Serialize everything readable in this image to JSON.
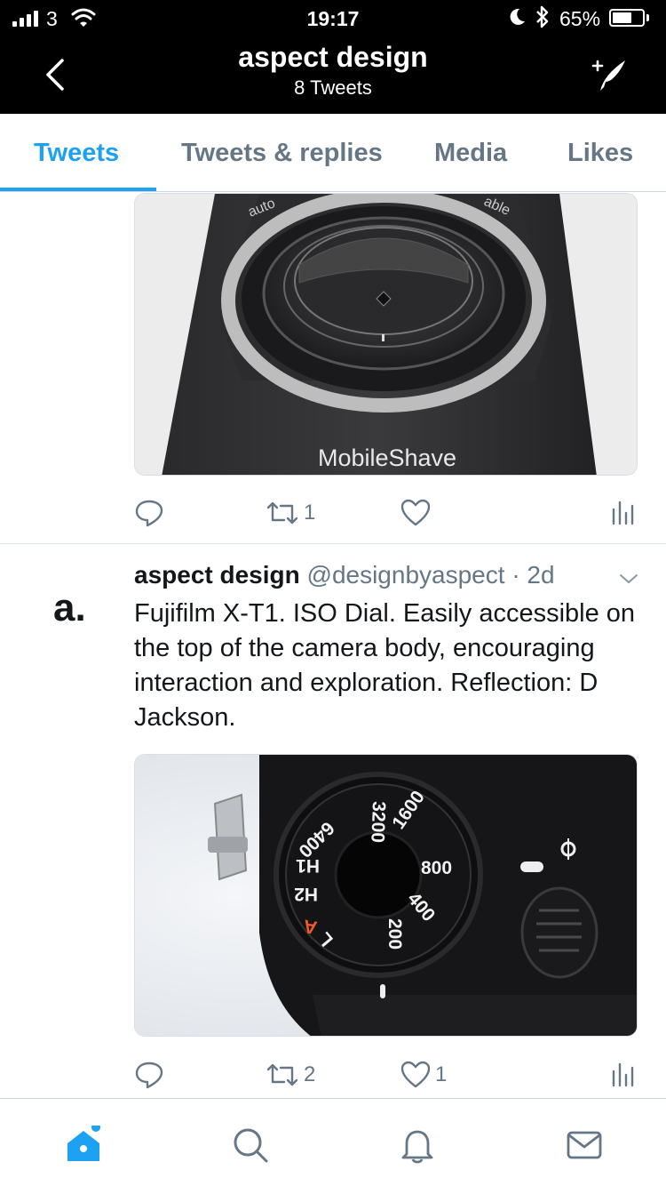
{
  "status_bar": {
    "carrier": "3",
    "time": "19:17",
    "battery_percent": "65%",
    "battery_level": 0.65,
    "icons": [
      "signal-icon",
      "wifi-icon",
      "moon-icon",
      "bluetooth-icon",
      "battery-icon"
    ]
  },
  "nav": {
    "title": "aspect design",
    "subtitle": "8 Tweets",
    "back_icon": "chevron-left-icon",
    "compose_icon": "compose-tweet-icon"
  },
  "tabs": [
    {
      "label": "Tweets",
      "active": true
    },
    {
      "label": "Tweets & replies",
      "active": false
    },
    {
      "label": "Media",
      "active": false
    },
    {
      "label": "Likes",
      "active": false
    }
  ],
  "tweets": [
    {
      "media_caption": "MobileShave",
      "media_ring_labels": [
        "auto",
        "able"
      ],
      "replies": "",
      "retweets": "1",
      "likes": ""
    },
    {
      "avatar_text": "a.",
      "name": "aspect design",
      "handle": "@designbyaspect",
      "time": "· 2d",
      "text": "Fujifilm X-T1. ISO Dial. Easily accessible on the top of the camera body, encouraging interaction and exploration. Reflection: D Jackson.",
      "dial_labels": [
        "3200",
        "1600",
        "800",
        "400",
        "200",
        "L",
        "A",
        "H2",
        "H1",
        "6400"
      ],
      "replies": "",
      "retweets": "2",
      "likes": "1"
    }
  ],
  "bottom_bar": {
    "items": [
      "home-icon",
      "search-icon",
      "notifications-icon",
      "messages-icon"
    ],
    "accent": "#1da1f2",
    "inactive": "#657786"
  }
}
